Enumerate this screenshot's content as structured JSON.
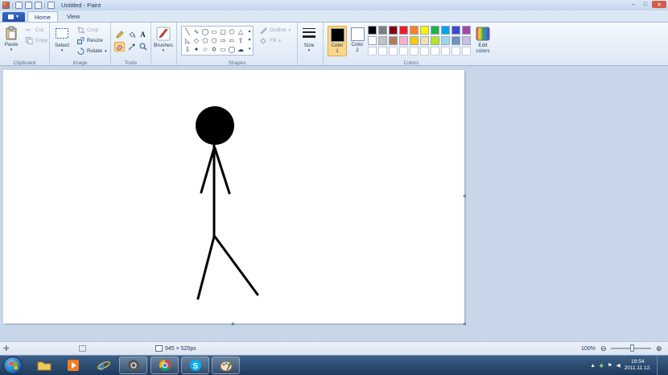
{
  "window": {
    "title": "Untitled - Paint",
    "controls": {
      "minimize": "–",
      "maximize": "□",
      "close": "✕"
    }
  },
  "ribbon_tabs": [
    {
      "label": "Home",
      "active": true
    },
    {
      "label": "View",
      "active": false
    }
  ],
  "ribbon": {
    "clipboard": {
      "group_label": "Clipboard",
      "paste_label": "Paste",
      "cut_label": "Cut",
      "copy_label": "Copy"
    },
    "image": {
      "group_label": "Image",
      "select_label": "Select",
      "crop_label": "Crop",
      "resize_label": "Resize",
      "rotate_label": "Rotate"
    },
    "tools": {
      "group_label": "Tools",
      "text_tool_glyph": "A"
    },
    "brushes": {
      "label": "Brushes"
    },
    "shapes": {
      "group_label": "Shapes",
      "outline_label": "Outline",
      "fill_label": "Fill"
    },
    "size": {
      "label": "Size"
    },
    "colors": {
      "group_label": "Colors",
      "color1_label": "Color",
      "color1_num": "1",
      "color2_label": "Color",
      "color2_num": "2",
      "color1_value": "#000000",
      "color2_value": "#ffffff",
      "edit_label": "Edit",
      "edit_label2": "colors",
      "palette_row1": [
        "#000000",
        "#7f7f7f",
        "#880015",
        "#ed1c24",
        "#ff7f27",
        "#fff200",
        "#22b14c",
        "#00a2e8",
        "#3f48cc",
        "#a349a4"
      ],
      "palette_row2": [
        "#ffffff",
        "#c3c3c3",
        "#b97a57",
        "#ffaec9",
        "#ffc90e",
        "#efe4b0",
        "#b5e61d",
        "#99d9ea",
        "#7092be",
        "#c8bfe7"
      ],
      "palette_row3": [
        "#ffffff",
        "#ffffff",
        "#ffffff",
        "#ffffff",
        "#ffffff",
        "#ffffff",
        "#ffffff",
        "#ffffff",
        "#ffffff",
        "#ffffff"
      ]
    }
  },
  "canvas": {
    "drawing": "stick-figure",
    "stroke_color": "#000000"
  },
  "statusbar": {
    "dimensions": "945 × 520px",
    "zoom": "100%"
  },
  "taskbar": {
    "apps": [
      "explorer",
      "media-player",
      "internet-explorer",
      "opera",
      "chrome",
      "skype",
      "paint"
    ],
    "clock_time": "19:54",
    "clock_date": "2011.11.12."
  }
}
